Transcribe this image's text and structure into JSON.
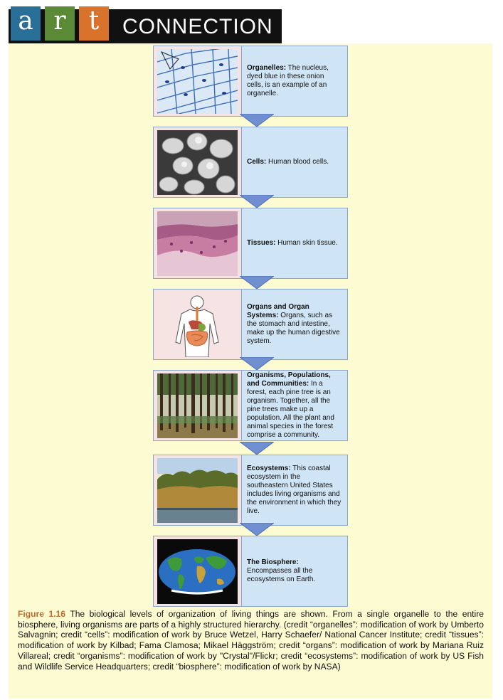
{
  "banner": {
    "letters": [
      "a",
      "r",
      "t"
    ],
    "word": "CONNECTION",
    "colors": {
      "a": "#2a6f98",
      "r": "#5b8a36",
      "t": "#d9722b",
      "panel": "#fdfbd2",
      "description_box": "#cfe4f4",
      "arrow": "#6f8fd0"
    }
  },
  "levels": [
    {
      "title": "Organelles:",
      "text": " The nucleus, dyed blue in these onion cells, is an example of an organelle.",
      "image": "onion-cells-image"
    },
    {
      "title": "Cells:",
      "text": " Human blood cells.",
      "image": "blood-cells-image"
    },
    {
      "title": "Tissues:",
      "text": " Human skin tissue.",
      "image": "skin-tissue-image"
    },
    {
      "title": "Organs and Organ Systems:",
      "text": " Organs, such as the stomach and intestine, make up the human digestive system.",
      "image": "digestive-system-image"
    },
    {
      "title": "Organisms, Populations, and Communities:",
      "text": " In a forest, each pine tree is an organism. Together, all the pine trees make up a population. All the plant and animal species in the forest comprise a community.",
      "image": "pine-forest-image"
    },
    {
      "title": "Ecosystems:",
      "text": " This coastal ecosystem in the southeastern United States includes living organisms and the environment in which they live.",
      "image": "coastal-ecosystem-image"
    },
    {
      "title": "The Biosphere:",
      "text": " Encompasses all the ecosystems on Earth.",
      "image": "world-map-image"
    }
  ],
  "caption": {
    "label": "Figure 1.16",
    "text": " The biological levels of organization of living things are shown. From a single organelle to the entire biosphere, living organisms are parts of a highly structured hierarchy. (credit “organelles”: modification of work by Umberto Salvagnin; credit “cells”: modification of work by Bruce Wetzel, Harry Schaefer/ National Cancer Institute; credit “tissues”: modification of work by Kilbad; Fama Clamosa; Mikael Häggström; credit “organs”: modification of work by Mariana Ruiz Villareal; credit “organisms”: modification of work by \"Crystal\"/Flickr; credit “ecosystems”: modification of work by US Fish and Wildlife Service Headquarters; credit “biosphere”: modification of work by NASA)"
  }
}
